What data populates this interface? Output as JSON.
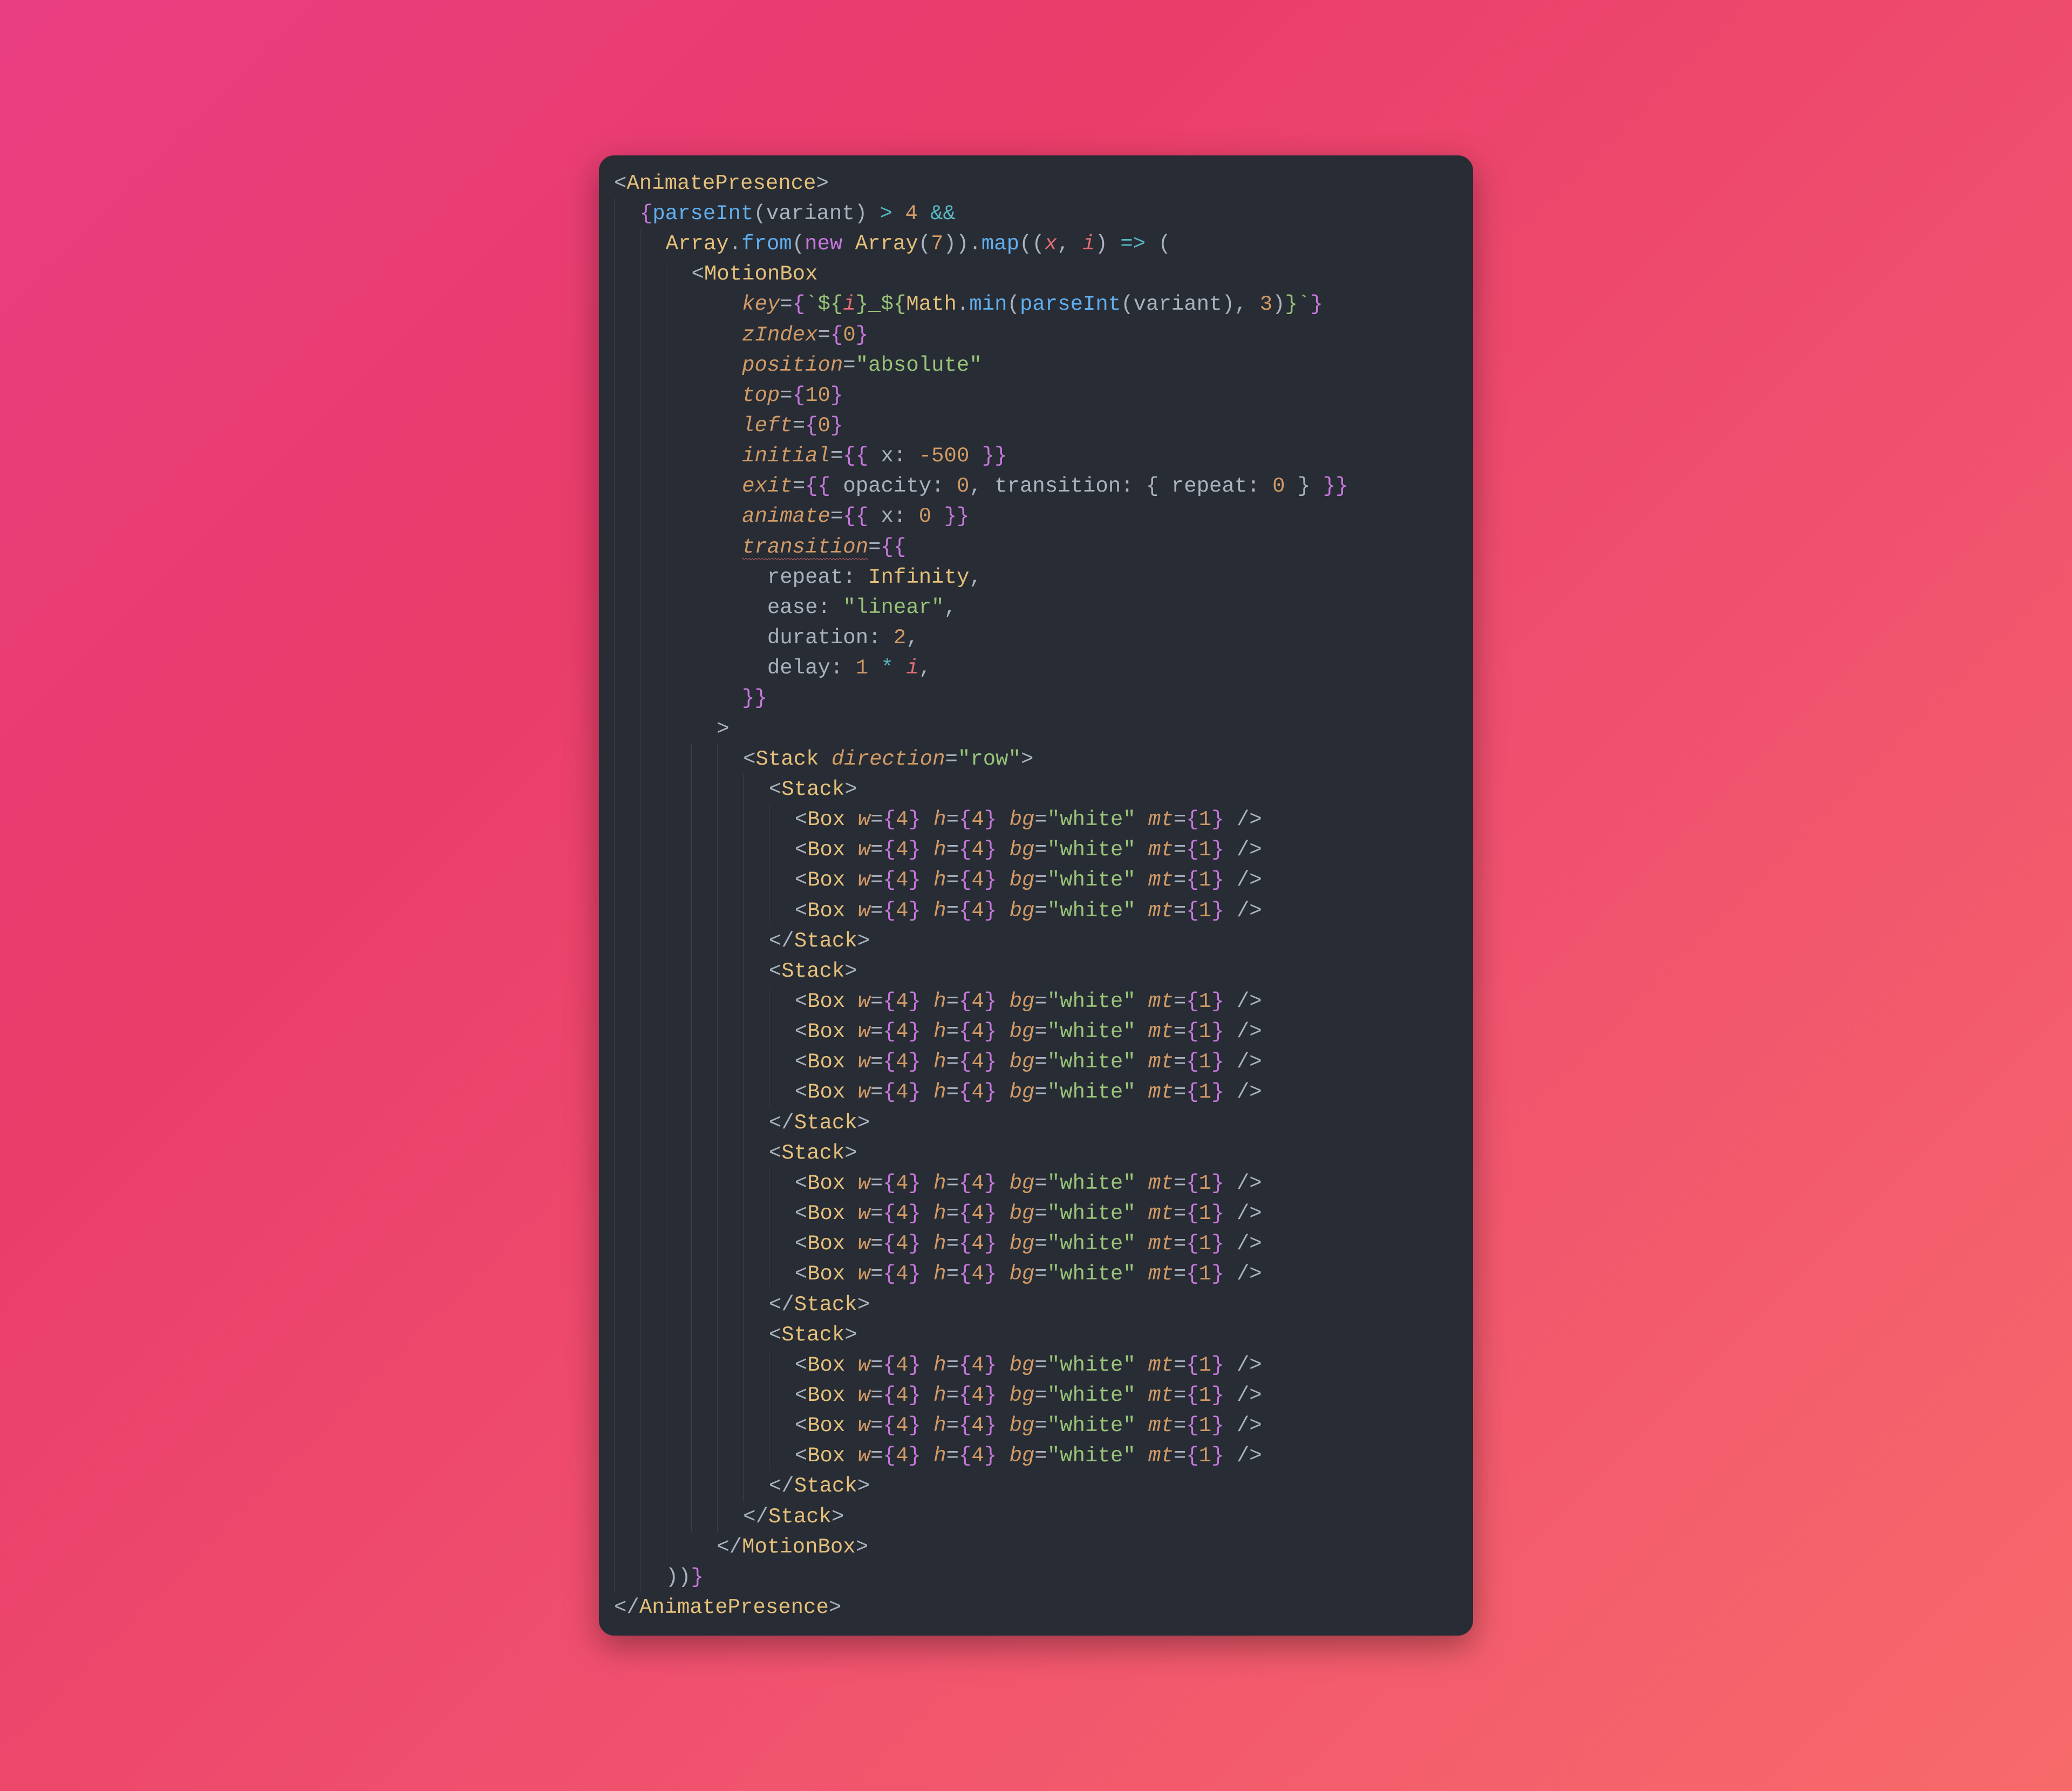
{
  "tokens": {
    "tag_animate_presence": "AnimatePresence",
    "tag_motion_box": "MotionBox",
    "tag_stack": "Stack",
    "tag_box": "Box",
    "fn_parse_int": "parseInt",
    "fn_from": "from",
    "fn_map": "map",
    "fn_min": "min",
    "cls_array": "Array",
    "cls_math": "Math",
    "kw_new": "new",
    "var_variant": "variant",
    "var_x": "x",
    "var_i": "i",
    "attr_key": "key",
    "attr_z_index": "zIndex",
    "attr_position": "position",
    "attr_top": "top",
    "attr_left": "left",
    "attr_initial": "initial",
    "attr_exit": "exit",
    "attr_animate": "animate",
    "attr_transition": "transition",
    "attr_direction": "direction",
    "attr_w": "w",
    "attr_h": "h",
    "attr_bg": "bg",
    "attr_mt": "mt",
    "val_absolute": "\"absolute\"",
    "val_linear": "\"linear\"",
    "val_row": "\"row\"",
    "val_white": "\"white\"",
    "num_4": "4",
    "num_7": "7",
    "num_0": "0",
    "num_10": "10",
    "num_neg500": "-500",
    "num_3": "3",
    "num_2": "2",
    "num_1": "1",
    "obj_repeat": "repeat",
    "obj_ease": "ease",
    "obj_duration": "duration",
    "obj_delay": "delay",
    "obj_opacity": "opacity",
    "obj_transition": "transition",
    "obj_x": "x",
    "const_infinity": "Infinity",
    "op_gt": ">",
    "op_and": "&&",
    "op_arrow": "=>",
    "op_star": "*"
  },
  "structure": {
    "stack_count": 4,
    "boxes_per_stack": 4,
    "map_array_length": 7,
    "variant_threshold": 4
  }
}
